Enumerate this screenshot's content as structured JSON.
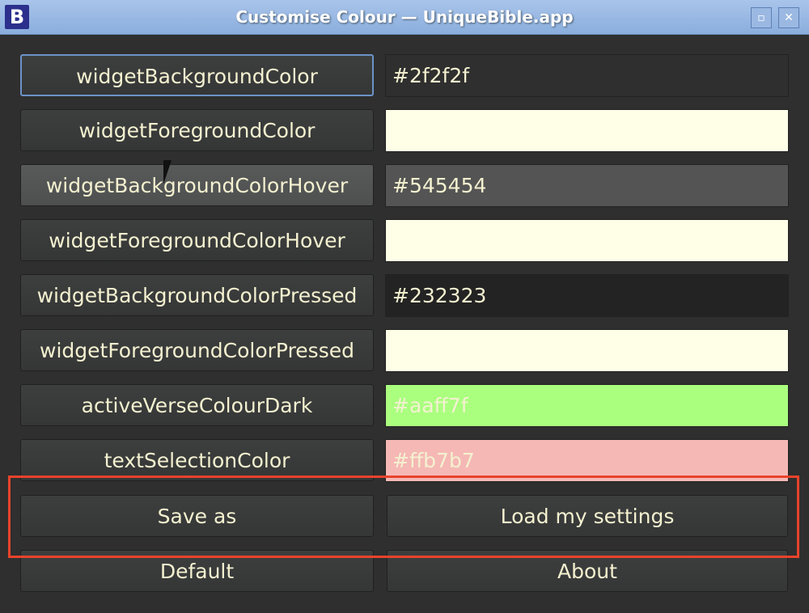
{
  "window": {
    "title": "Customise Colour — UniqueBible.app",
    "logo": "B",
    "maximize_icon": "▫",
    "close_icon": "✕"
  },
  "rows": [
    {
      "label": "widgetBackgroundColor",
      "value": "#2f2f2f",
      "color": "#2f2f2f"
    },
    {
      "label": "widgetForegroundColor",
      "value": "",
      "color": "#ffffe8"
    },
    {
      "label": "widgetBackgroundColorHover",
      "value": "#545454",
      "color": "#545454"
    },
    {
      "label": "widgetForegroundColorHover",
      "value": "",
      "color": "#ffffe8"
    },
    {
      "label": "widgetBackgroundColorPressed",
      "value": "#232323",
      "color": "#232323"
    },
    {
      "label": "widgetForegroundColorPressed",
      "value": "",
      "color": "#ffffe8"
    },
    {
      "label": "activeVerseColourDark",
      "value": "#aaff7f",
      "color": "#aaff7f"
    },
    {
      "label": "textSelectionColor",
      "value": "#ffb7b7",
      "color": "#f5b8b5"
    }
  ],
  "buttons": {
    "save_as": "Save as",
    "load": "Load my settings",
    "default": "Default",
    "about": "About"
  }
}
